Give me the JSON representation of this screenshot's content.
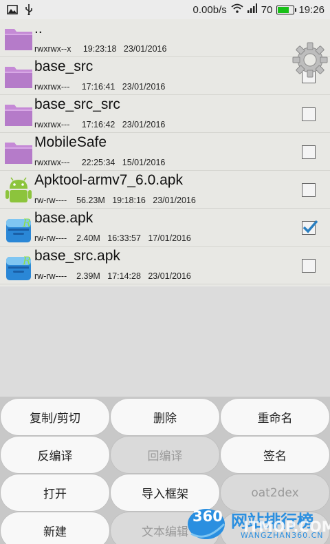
{
  "status_bar": {
    "speed": "0.00b/s",
    "battery": "70",
    "time": "19:26",
    "battery_level": 0.7
  },
  "files": [
    {
      "name": "..",
      "meta": "rwxrwx--x     19:23:18   23/01/2016",
      "type": "folder",
      "checkbox": false
    },
    {
      "name": "base_src",
      "meta": "rwxrwx---     17:16:41   23/01/2016",
      "type": "folder",
      "checkbox": true,
      "checked": false
    },
    {
      "name": "base_src_src",
      "meta": "rwxrwx---     17:16:42   23/01/2016",
      "type": "folder",
      "checkbox": true,
      "checked": false
    },
    {
      "name": "MobileSafe",
      "meta": "rwxrwx---     22:25:34   15/01/2016",
      "type": "folder",
      "checkbox": true,
      "checked": false
    },
    {
      "name": "Apktool-armv7_6.0.apk",
      "meta": "rw-rw----    56.23M   19:18:16   23/01/2016",
      "type": "android",
      "checkbox": true,
      "checked": false
    },
    {
      "name": "base.apk",
      "meta": "rw-rw----    2.40M   16:33:57   17/01/2016",
      "type": "apk",
      "checkbox": true,
      "checked": true
    },
    {
      "name": "base_src.apk",
      "meta": "rw-rw----    2.39M   17:14:28   23/01/2016",
      "type": "apk",
      "checkbox": true,
      "checked": false
    }
  ],
  "buttons": [
    {
      "label": "复制/剪切",
      "enabled": true
    },
    {
      "label": "删除",
      "enabled": true
    },
    {
      "label": "重命名",
      "enabled": true
    },
    {
      "label": "反编译",
      "enabled": true
    },
    {
      "label": "回编译",
      "enabled": false
    },
    {
      "label": "签名",
      "enabled": true
    },
    {
      "label": "打开",
      "enabled": true
    },
    {
      "label": "导入框架",
      "enabled": true
    },
    {
      "label": "oat2dex",
      "enabled": false
    },
    {
      "label": "新建",
      "enabled": true
    },
    {
      "label": "文本编辑",
      "enabled": false
    },
    {
      "label": "",
      "enabled": false
    }
  ],
  "watermark": {
    "logo_text": "360",
    "title": "网站排行榜",
    "subtitle": "WANGZHAN360.CN",
    "overlay": "ITMOP.COM"
  },
  "colors": {
    "folder": "#c58ad6",
    "checkmark": "#2a7fc0",
    "battery": "#18c018",
    "watermark_blue": "#2a8fe0"
  }
}
